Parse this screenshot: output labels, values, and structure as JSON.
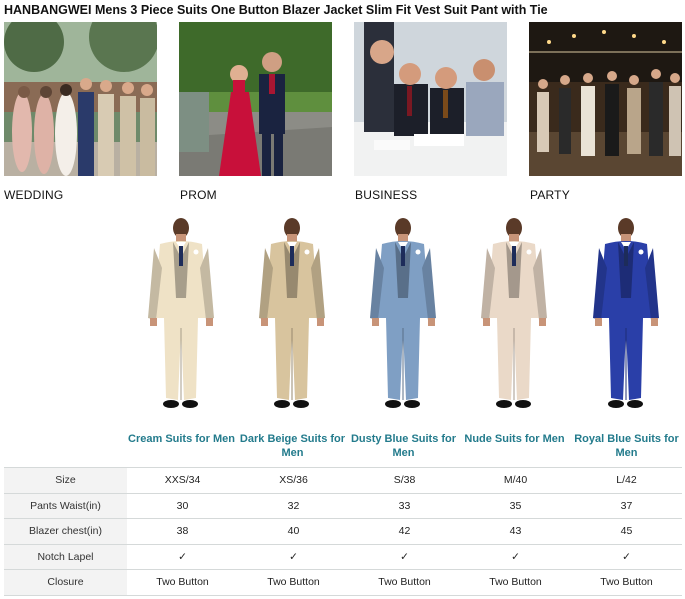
{
  "page": {
    "title": "HANBANGWEI Mens 3 Piece Suits One Button Blazer Jacket Slim Fit Vest Suit Pant with Tie"
  },
  "occasions": [
    {
      "label": "WEDDING"
    },
    {
      "label": "PROM"
    },
    {
      "label": "BUSINESS"
    },
    {
      "label": "PARTY"
    }
  ],
  "suits": [
    {
      "name": "Cream Suits for Men",
      "color": "#efe2c6"
    },
    {
      "name": "Dark Beige Suits for Men",
      "color": "#d8c49e"
    },
    {
      "name": "Dusty Blue Suits for Men",
      "color": "#7f9fc4"
    },
    {
      "name": "Nude Suits for Men",
      "color": "#ead9c8"
    },
    {
      "name": "Royal Blue Suits for Men",
      "color": "#2a3fa8"
    }
  ],
  "table": {
    "rows": [
      {
        "label": "Size",
        "values": [
          "XXS/34",
          "XS/36",
          "S/38",
          "M/40",
          "L/42"
        ]
      },
      {
        "label": "Pants Waist(in)",
        "values": [
          "30",
          "32",
          "33",
          "35",
          "37"
        ]
      },
      {
        "label": "Blazer chest(in)",
        "values": [
          "38",
          "40",
          "42",
          "43",
          "45"
        ]
      },
      {
        "label": "Notch Lapel",
        "values": [
          "✓",
          "✓",
          "✓",
          "✓",
          "✓"
        ]
      },
      {
        "label": "Closure",
        "values": [
          "Two Button",
          "Two Button",
          "Two Button",
          "Two Button",
          "Two Button"
        ]
      }
    ]
  },
  "colors": {
    "accent_text": "#237b8c",
    "table_header_bg": "#f3f3f3",
    "table_border": "#d5d9d9"
  }
}
